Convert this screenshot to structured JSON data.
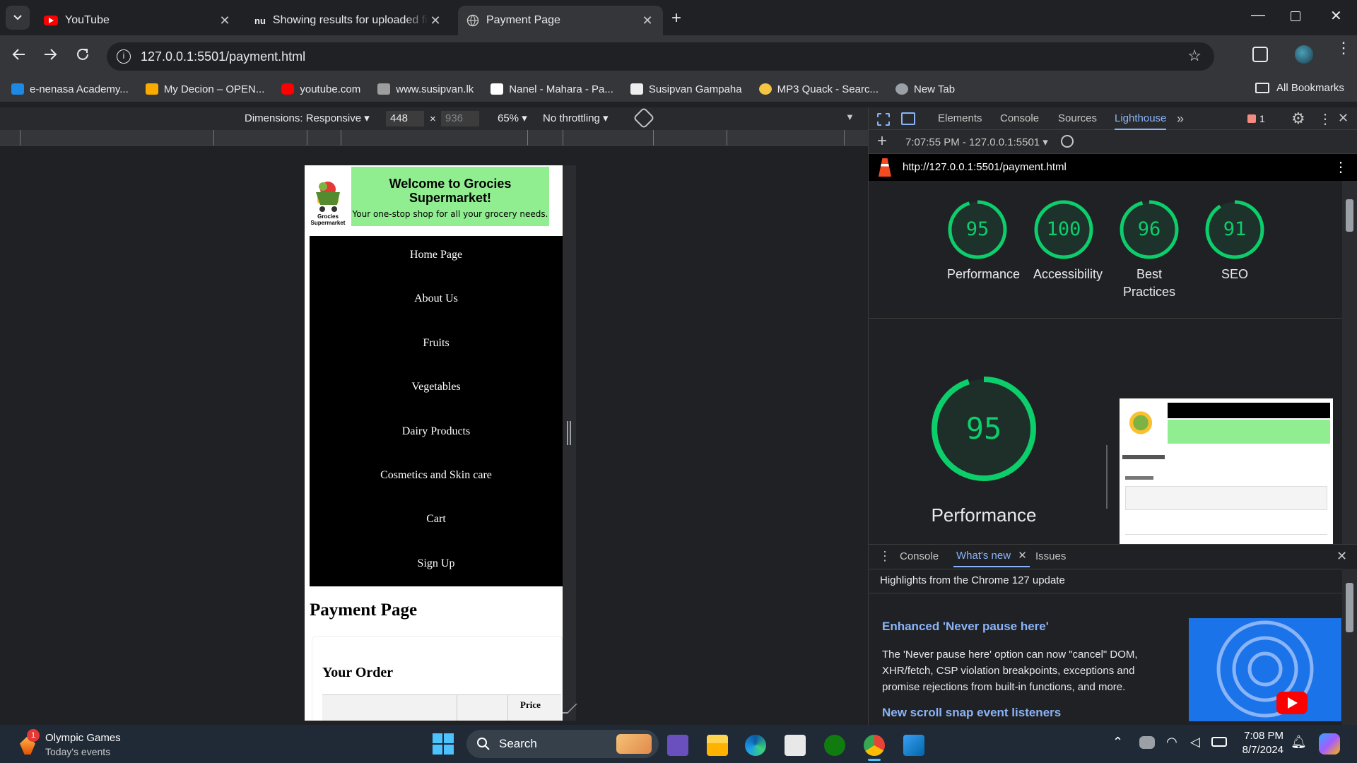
{
  "browser": {
    "tabs": [
      {
        "title": "YouTube",
        "icon": "youtube-icon"
      },
      {
        "title": "Showing results for uploaded fi",
        "icon": "nu-icon"
      },
      {
        "title": "Payment Page",
        "icon": "globe-icon"
      }
    ],
    "url": "127.0.0.1:5501/payment.html",
    "bookmarks": [
      {
        "label": "e-nenasa Academy...",
        "color": "#1e88e5"
      },
      {
        "label": "My Decion – OPEN...",
        "color": "#f9ab00"
      },
      {
        "label": "youtube.com",
        "color": "#ff0000"
      },
      {
        "label": "www.susipvan.lk",
        "color": "#9e9e9e"
      },
      {
        "label": "Nanel - Mahara - Pa...",
        "color": "#ffffff"
      },
      {
        "label": "Susipvan Gampaha",
        "color": "#eeeeee"
      },
      {
        "label": "MP3 Quack - Searc...",
        "color": "#f4c542"
      },
      {
        "label": "New Tab",
        "color": "#9aa0a6"
      }
    ],
    "all_bookmarks": "All Bookmarks"
  },
  "device_toolbar": {
    "dimensions": "Dimensions: Responsive",
    "width": "448",
    "height": "936",
    "times": "×",
    "zoom": "65%",
    "throttling": "No throttling"
  },
  "site": {
    "welcome": "Welcome to Grocies Supermarket!",
    "tagline": "Your one-stop shop for all your grocery needs.",
    "logo_text": "Grocies Supermarket",
    "nav": [
      "Home Page",
      "About Us",
      "Fruits",
      "Vegetables",
      "Dairy Products",
      "Cosmetics and Skin care",
      "Cart",
      "Sign Up"
    ],
    "page_title": "Payment Page",
    "order_title": "Your Order",
    "table_header_price": "Price"
  },
  "devtools": {
    "tabs": [
      "Elements",
      "Console",
      "Sources",
      "Lighthouse"
    ],
    "active_tab": "Lighthouse",
    "issues_count": "1",
    "report_time": "7:07:55 PM - 127.0.0.1:5501",
    "report_url": "http://127.0.0.1:5501/payment.html",
    "scores": [
      {
        "label": "Performance",
        "value": 95
      },
      {
        "label": "Accessibility",
        "value": 100
      },
      {
        "label": "Best Practices",
        "value": 96
      },
      {
        "label": "SEO",
        "value": 91
      }
    ],
    "big_score": {
      "label": "Performance",
      "value": 95
    },
    "drawer_tabs": [
      "Console",
      "What's new",
      "Issues"
    ],
    "drawer_heading": "Highlights from the Chrome 127 update",
    "article1_title": "Enhanced 'Never pause here'",
    "article1_body": "The 'Never pause here' option can now \"cancel\" DOM, XHR/fetch, CSP violation breakpoints, exceptions and promise rejections from built-in functions, and more.",
    "article2_title": "New scroll snap event listeners",
    "accent": "#0cce6b",
    "link_color": "#8ab4f8"
  },
  "taskbar": {
    "weather_title": "Olympic Games",
    "weather_sub": "Today's events",
    "weather_badge": "1",
    "search": "Search",
    "time": "7:08 PM",
    "date": "8/7/2024"
  }
}
